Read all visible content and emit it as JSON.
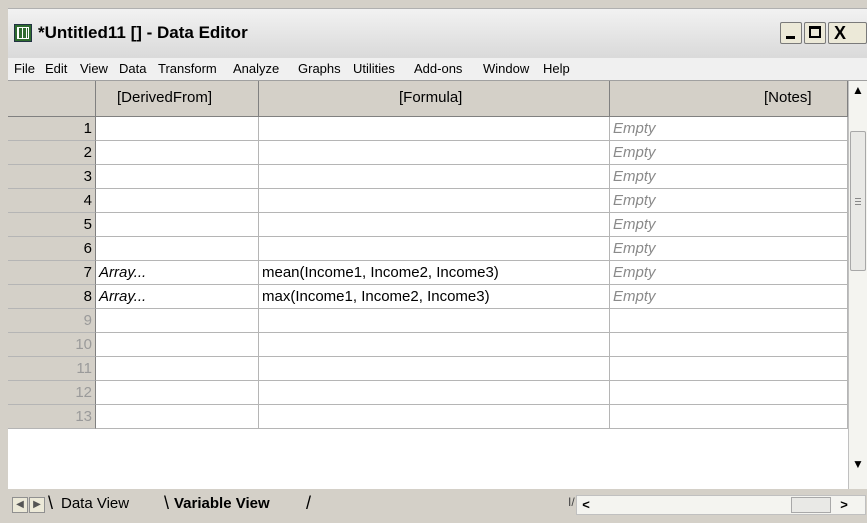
{
  "window": {
    "title": "*Untitled11 [] - Data Editor",
    "close_glyph": "X"
  },
  "menu": [
    "File",
    "Edit",
    "View",
    "Data",
    "Transform",
    "Analyze",
    "Graphs",
    "Utilities",
    "Add-ons",
    "Window",
    "Help"
  ],
  "grid": {
    "columns": [
      "[DerivedFrom]",
      "[Formula]",
      "[Notes]"
    ],
    "rows": [
      {
        "num": "1",
        "derived": "",
        "formula": "",
        "notes": "Empty"
      },
      {
        "num": "2",
        "derived": "",
        "formula": "",
        "notes": "Empty"
      },
      {
        "num": "3",
        "derived": "",
        "formula": "",
        "notes": "Empty"
      },
      {
        "num": "4",
        "derived": "",
        "formula": "",
        "notes": "Empty"
      },
      {
        "num": "5",
        "derived": "",
        "formula": "",
        "notes": "Empty"
      },
      {
        "num": "6",
        "derived": "",
        "formula": "",
        "notes": "Empty"
      },
      {
        "num": "7",
        "derived": "Array...",
        "formula": "mean(Income1, Income2, Income3)",
        "notes": "Empty"
      },
      {
        "num": "8",
        "derived": "Array...",
        "formula": "max(Income1, Income2, Income3)",
        "notes": "Empty"
      },
      {
        "num": "9",
        "derived": "",
        "formula": "",
        "notes": ""
      },
      {
        "num": "10",
        "derived": "",
        "formula": "",
        "notes": ""
      },
      {
        "num": "11",
        "derived": "",
        "formula": "",
        "notes": ""
      },
      {
        "num": "12",
        "derived": "",
        "formula": "",
        "notes": ""
      },
      {
        "num": "13",
        "derived": "",
        "formula": "",
        "notes": ""
      }
    ]
  },
  "tabs": {
    "data_view": "Data View",
    "variable_view": "Variable View",
    "active": "variable_view"
  },
  "icons": {
    "app": "data-editor-icon",
    "minimize": "minimize-icon",
    "maximize": "maximize-icon",
    "close": "close-icon"
  }
}
